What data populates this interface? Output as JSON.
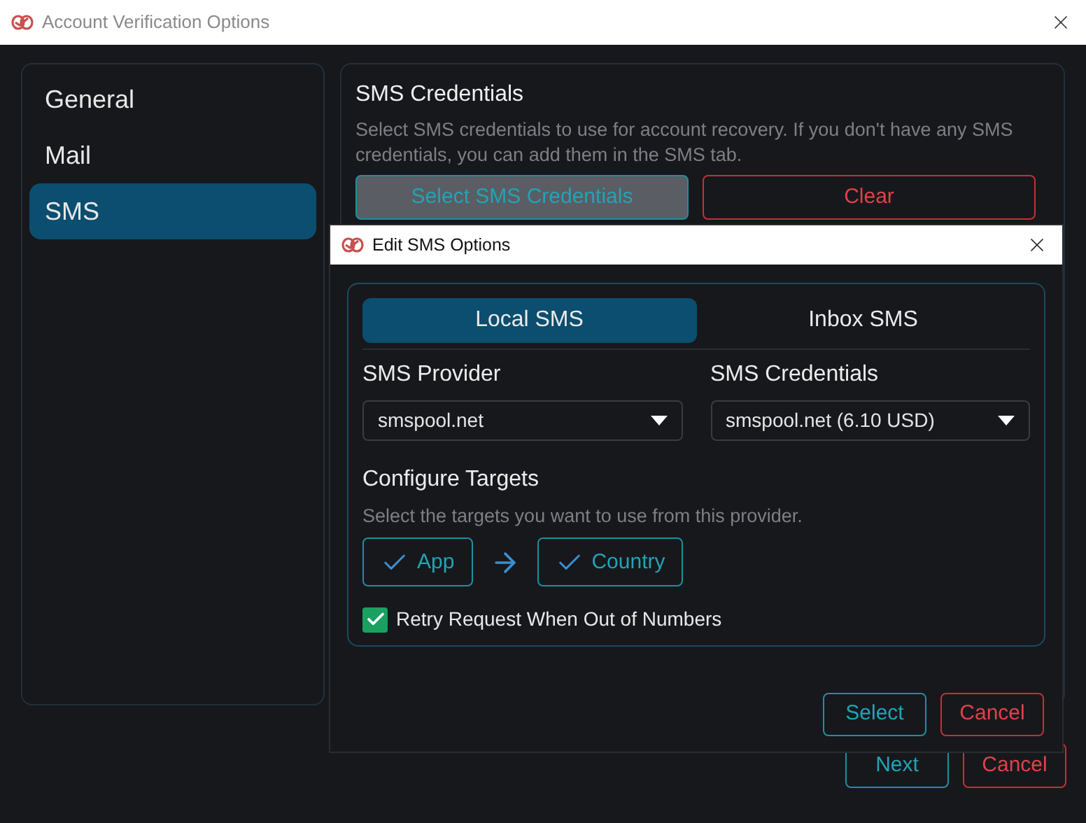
{
  "window": {
    "title": "Account Verification Options"
  },
  "sidebar": {
    "items": [
      {
        "label": "General",
        "selected": false
      },
      {
        "label": "Mail",
        "selected": false
      },
      {
        "label": "SMS",
        "selected": true
      }
    ]
  },
  "section": {
    "title": "SMS Credentials",
    "description": "Select SMS credentials to use for account recovery. If you don't have any SMS credentials, you can add them in the SMS tab.",
    "buttons": [
      {
        "label": "Select SMS Credentials",
        "kind": "primary",
        "disabled": true
      },
      {
        "label": "Clear",
        "kind": "danger",
        "disabled": false
      }
    ]
  },
  "dialog": {
    "title": "Edit SMS Options",
    "tabs": [
      {
        "label": "Local SMS",
        "selected": true
      },
      {
        "label": "Inbox SMS",
        "selected": false
      }
    ],
    "fields": [
      {
        "label": "SMS Provider",
        "value": "smspool.net"
      },
      {
        "label": "SMS Credentials",
        "value": "smspool.net (6.10 USD)"
      }
    ],
    "targets": {
      "title": "Configure Targets",
      "description": "Select the targets you want to use from this provider.",
      "items": [
        {
          "label": "App",
          "checked": true
        },
        {
          "label": "Country",
          "checked": true
        }
      ]
    },
    "option": {
      "label": "Retry Request When Out of Numbers",
      "checked": true
    },
    "buttons": [
      {
        "label": "Select",
        "kind": "primary"
      },
      {
        "label": "Cancel",
        "kind": "danger"
      }
    ]
  },
  "footer": {
    "buttons": [
      {
        "label": "Next",
        "kind": "primary"
      },
      {
        "label": "Cancel",
        "kind": "danger"
      }
    ]
  }
}
